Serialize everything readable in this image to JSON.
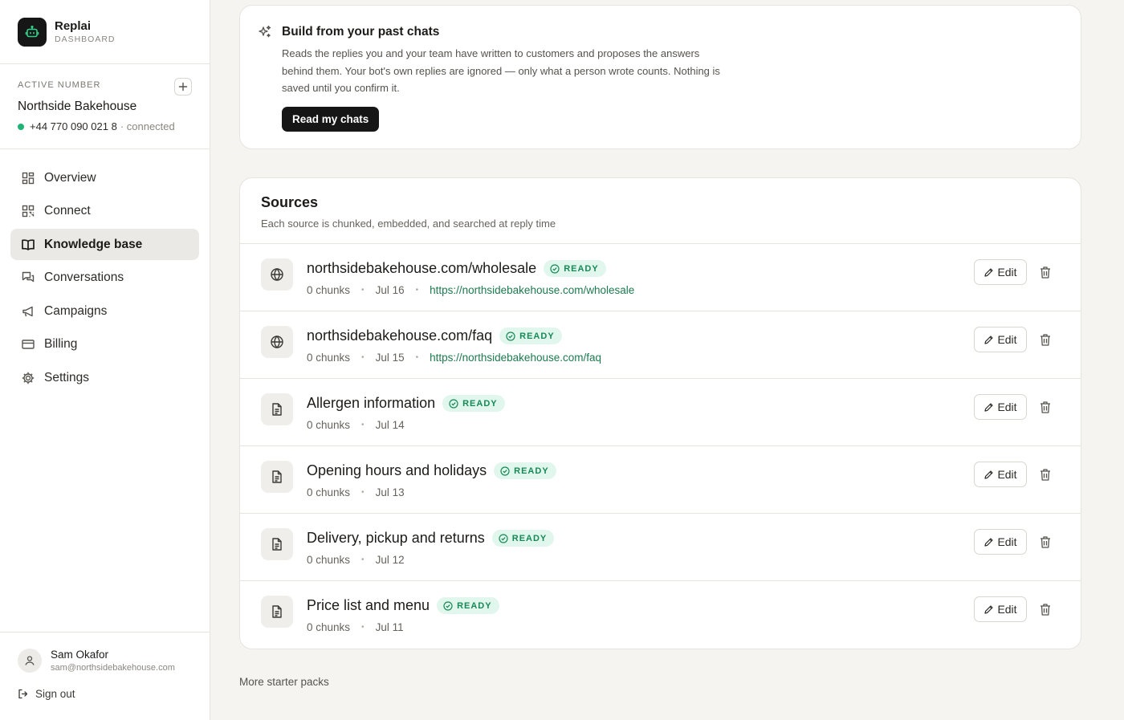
{
  "brand": {
    "name": "Replai",
    "subtitle": "DASHBOARD"
  },
  "active_number": {
    "label": "ACTIVE NUMBER",
    "business": "Northside Bakehouse",
    "phone": "+44 770 090 021 8",
    "status": "· connected",
    "status_color": "#1fb374"
  },
  "nav": [
    {
      "label": "Overview",
      "icon": "grid-icon",
      "active": false
    },
    {
      "label": "Connect",
      "icon": "qr-code-icon",
      "active": false
    },
    {
      "label": "Knowledge base",
      "icon": "book-icon",
      "active": true
    },
    {
      "label": "Conversations",
      "icon": "chat-bubbles-icon",
      "active": false
    },
    {
      "label": "Campaigns",
      "icon": "megaphone-icon",
      "active": false
    },
    {
      "label": "Billing",
      "icon": "credit-card-icon",
      "active": false
    },
    {
      "label": "Settings",
      "icon": "gear-icon",
      "active": false
    }
  ],
  "user": {
    "name": "Sam Okafor",
    "email": "sam@northsidebakehouse.com",
    "sign_out": "Sign out"
  },
  "build": {
    "title": "Build from your past chats",
    "description": "Reads the replies you and your team have written to customers and proposes the answers behind them. Your bot's own replies are ignored — only what a person wrote counts. Nothing is saved until you confirm it.",
    "button": "Read my chats"
  },
  "sources": {
    "title": "Sources",
    "subtitle": "Each source is chunked, embedded, and searched at reply time",
    "edit_label": "Edit",
    "items": [
      {
        "title": "northsidebakehouse.com/wholesale",
        "type": "web",
        "status": "READY",
        "chunks": "0 chunks",
        "date": "Jul 16",
        "url": "https://northsidebakehouse.com/wholesale"
      },
      {
        "title": "northsidebakehouse.com/faq",
        "type": "web",
        "status": "READY",
        "chunks": "0 chunks",
        "date": "Jul 15",
        "url": "https://northsidebakehouse.com/faq"
      },
      {
        "title": "Allergen information",
        "type": "doc",
        "status": "READY",
        "chunks": "0 chunks",
        "date": "Jul 14",
        "url": ""
      },
      {
        "title": "Opening hours and holidays",
        "type": "doc",
        "status": "READY",
        "chunks": "0 chunks",
        "date": "Jul 13",
        "url": ""
      },
      {
        "title": "Delivery, pickup and returns",
        "type": "doc",
        "status": "READY",
        "chunks": "0 chunks",
        "date": "Jul 12",
        "url": ""
      },
      {
        "title": "Price list and menu",
        "type": "doc",
        "status": "READY",
        "chunks": "0 chunks",
        "date": "Jul 11",
        "url": ""
      }
    ]
  },
  "more_link": "More starter packs",
  "colors": {
    "accent_dark": "#161616",
    "ready_bg": "#e1f6ec",
    "ready_text": "#168a56",
    "link": "#1d7a4f"
  }
}
